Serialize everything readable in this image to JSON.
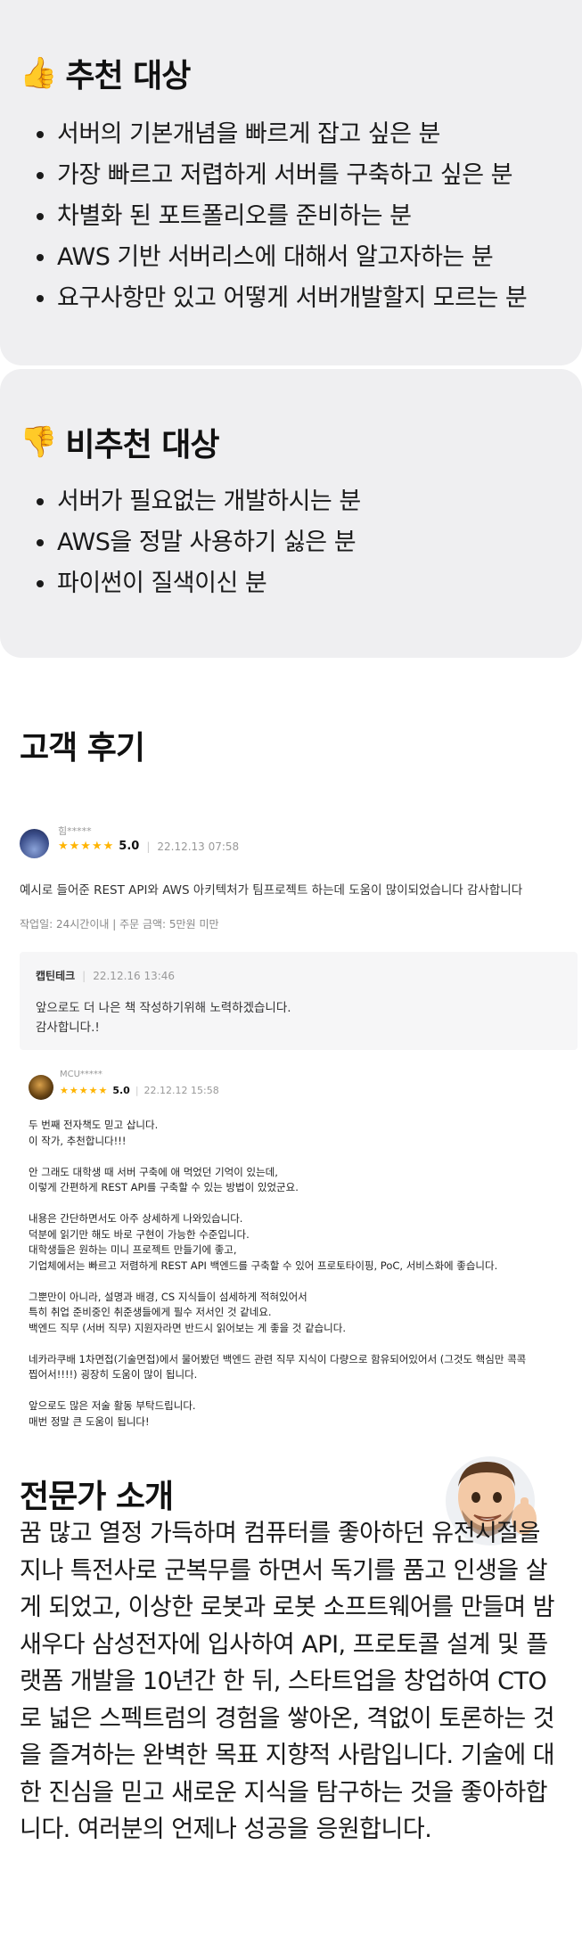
{
  "recommended": {
    "emoji": "👍",
    "title": "추천 대상",
    "items": [
      "서버의 기본개념을 빠르게 잡고 싶은 분",
      "가장 빠르고 저렵하게 서버를 구축하고 싶은 분",
      "차별화 된 포트폴리오를 준비하는 분",
      "AWS 기반 서버리스에 대해서 알고자하는 분",
      "요구사항만 있고 어떻게 서버개발할지 모르는 분"
    ]
  },
  "not_recommended": {
    "emoji": "👎",
    "title": "비추천 대상",
    "items": [
      "서버가 필요없는 개발하시는 분",
      "AWS을 정말 사용하기 싫은 분",
      "파이썬이 질색이신 분"
    ]
  },
  "reviews_section": {
    "title": "고객 후기",
    "reviews": [
      {
        "name": "힘*****",
        "stars": "★★★★★",
        "rating": "5.0",
        "date": "22.12.13 07:58",
        "text": "예시로 들어준 REST API와 AWS 아키텍처가 팀프로젝트 하는데 도움이 많이되었습니다 감사합니다",
        "work_info": "작업일: 24시간이내 | 주문 금액: 5만원 미만",
        "reply": {
          "author": "캡틴테크",
          "date": "22.12.16 13:46",
          "text": "앞으로도 더 나은 책 작성하기위해 노력하겠습니다.\n감사합니다.!"
        }
      },
      {
        "name": "MCU*****",
        "stars": "★★★★★",
        "rating": "5.0",
        "date": "22.12.12 15:58",
        "text": "두 번째 전자책도 믿고 삽니다.\n이 작가, 추천합니다!!!\n\n안 그래도 대학생 때 서버 구축에 애 먹었던 기억이 있는데,\n이렇게 간편하게 REST API를 구축할 수 있는 방법이 있었군요.\n\n내용은 간단하면서도 아주 상세하게 나와있습니다.\n덕분에 읽기만 해도 바로 구현이 가능한 수준입니다.\n대학생들은 원하는 미니 프로젝트 만들기에 좋고,\n기업체에서는 빠르고 저렴하게 REST API 백엔드를 구축할 수 있어 프로토타이핑, PoC, 서비스화에 좋습니다.\n\n그뿐만이 아니라, 설명과 배경, CS 지식들이 섬세하게 적혀있어서\n특히 취업 준비중인 취준생들에게 필수 저서인 것 같네요.\n백엔드 직무 (서버 직무) 지원자라면 반드시 읽어보는 게 좋을 것 같습니다.\n\n네카라쿠배 1차면접(기술면접)에서 물어봤던 백엔드 관련 직무 지식이 다량으로 함유되어있어서 (그것도 핵심만 콕콕\n찝어서!!!!) 굉장히 도움이 많이 됩니다.\n\n앞으로도 많은 저술 활동 부탁드립니다.\n매번 정말 큰 도움이 됩니다!"
      }
    ]
  },
  "expert": {
    "title": "전문가 소개",
    "bio": "꿈 많고 열정 가득하며 컴퓨터를 좋아하던 유전시절을 지나 특전사로 군복무를 하면서 독기를 품고 인생을 살게 되었고, 이상한 로봇과 로봇 소프트웨어를 만들며 밤새우다 삼성전자에 입사하여 API, 프로토콜 설계 및 플랫폼 개발을 10년간 한 뒤, 스타트업을 창업하여 CTO로 넓은 스펙트럼의 경험을 쌓아온, 격없이 토론하는 것을 즐겨하는 완벽한 목표 지향적 사람입니다. 기술에 대한 진심을 믿고 새로운 지식을 탐구하는 것을 좋아하합니다. 여러분의 언제나 성공을 응원합니다."
  },
  "colors": {
    "card_bg": "#efeff1",
    "star": "#ffb400",
    "muted": "#999999"
  }
}
